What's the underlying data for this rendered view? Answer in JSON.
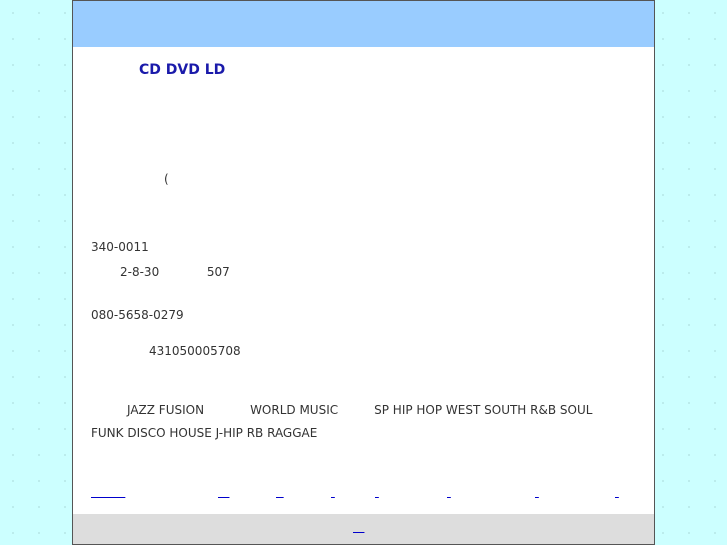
{
  "title": "CD DVD LD",
  "paren": "(",
  "postal_code": "340-0011",
  "address": "2-8-30 　 507",
  "phone": "080-5658-0279",
  "license_number": "431050005708",
  "genres": {
    "line1": [
      "JAZZ FUSION",
      "WORLD MUSIC",
      "SP HIP HOP WEST SOUTH R&B SOUL"
    ],
    "line2": "FUNK DISCO HOUSE J-HIP RB RAGGAE"
  },
  "nav_links": [
    "         ",
    "   ",
    "  ",
    " ",
    " ",
    " ",
    " ",
    " "
  ],
  "footer_link": "   "
}
